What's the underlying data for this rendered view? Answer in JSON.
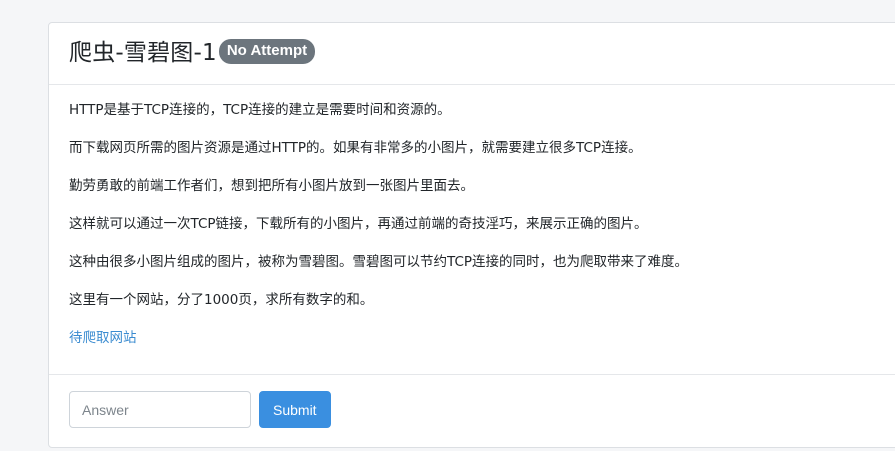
{
  "challenge": {
    "title": "爬虫-雪碧图-1",
    "status_badge": "No Attempt"
  },
  "description": {
    "paragraphs": [
      "HTTP是基于TCP连接的，TCP连接的建立是需要时间和资源的。",
      "而下载网页所需的图片资源是通过HTTP的。如果有非常多的小图片，就需要建立很多TCP连接。",
      "勤劳勇敢的前端工作者们，想到把所有小图片放到一张图片里面去。",
      "这样就可以通过一次TCP链接，下载所有的小图片，再通过前端的奇技淫巧，来展示正确的图片。",
      "这种由很多小图片组成的图片，被称为雪碧图。雪碧图可以节约TCP连接的同时，也为爬取带来了难度。",
      "这里有一个网站，分了1000页，求所有数字的和。"
    ],
    "link_text": "待爬取网站"
  },
  "form": {
    "answer_placeholder": "Answer",
    "answer_value": "",
    "submit_label": "Submit"
  },
  "colors": {
    "badge": "#6c757d",
    "link": "#3a8bd0",
    "submit": "#3a8fe0"
  }
}
